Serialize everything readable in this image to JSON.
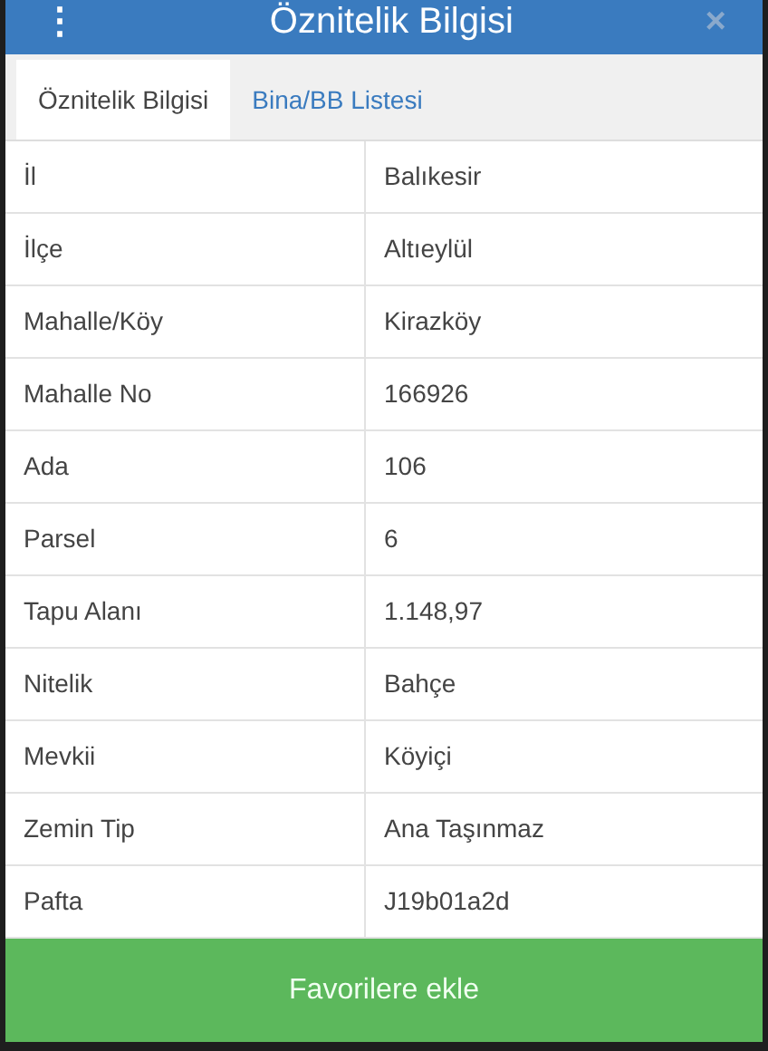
{
  "header": {
    "title": "Öznitelik Bilgisi",
    "menu_icon": "⋮",
    "close_icon": "×"
  },
  "tabs": [
    {
      "label": "Öznitelik Bilgisi",
      "selected": true
    },
    {
      "label": "Bina/BB Listesi",
      "selected": false
    }
  ],
  "rows": [
    {
      "label": "İl",
      "value": "Balıkesir"
    },
    {
      "label": "İlçe",
      "value": "Altıeylül"
    },
    {
      "label": "Mahalle/Köy",
      "value": "Kirazköy"
    },
    {
      "label": "Mahalle No",
      "value": "166926"
    },
    {
      "label": "Ada",
      "value": "106"
    },
    {
      "label": "Parsel",
      "value": "6"
    },
    {
      "label": "Tapu Alanı",
      "value": "1.148,97"
    },
    {
      "label": "Nitelik",
      "value": "Bahçe"
    },
    {
      "label": "Mevkii",
      "value": "Köyiçi"
    },
    {
      "label": "Zemin Tip",
      "value": "Ana Taşınmaz"
    },
    {
      "label": "Pafta",
      "value": "J19b01a2d"
    }
  ],
  "button": {
    "label": "Favorilere ekle"
  }
}
